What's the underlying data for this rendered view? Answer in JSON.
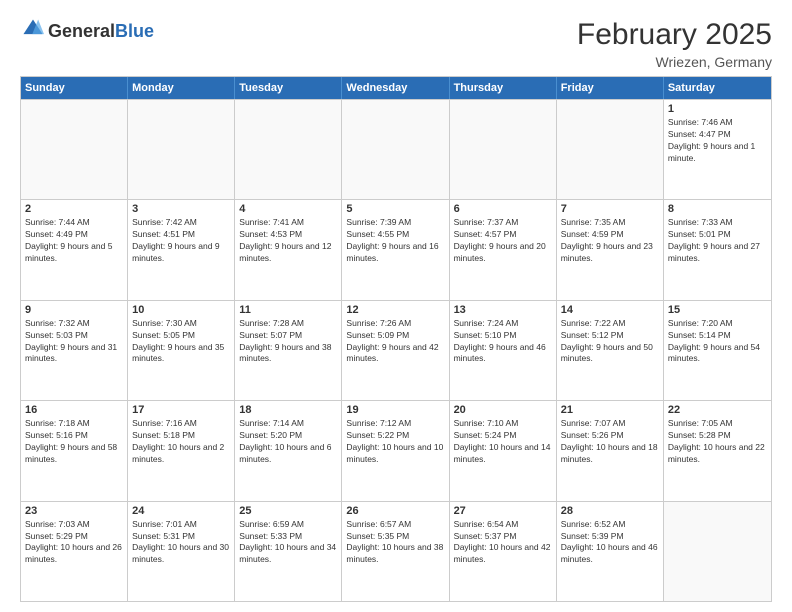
{
  "header": {
    "logo_general": "General",
    "logo_blue": "Blue",
    "month_title": "February 2025",
    "location": "Wriezen, Germany"
  },
  "weekdays": [
    "Sunday",
    "Monday",
    "Tuesday",
    "Wednesday",
    "Thursday",
    "Friday",
    "Saturday"
  ],
  "rows": [
    [
      {
        "day": "",
        "info": ""
      },
      {
        "day": "",
        "info": ""
      },
      {
        "day": "",
        "info": ""
      },
      {
        "day": "",
        "info": ""
      },
      {
        "day": "",
        "info": ""
      },
      {
        "day": "",
        "info": ""
      },
      {
        "day": "1",
        "info": "Sunrise: 7:46 AM\nSunset: 4:47 PM\nDaylight: 9 hours and 1 minute."
      }
    ],
    [
      {
        "day": "2",
        "info": "Sunrise: 7:44 AM\nSunset: 4:49 PM\nDaylight: 9 hours and 5 minutes."
      },
      {
        "day": "3",
        "info": "Sunrise: 7:42 AM\nSunset: 4:51 PM\nDaylight: 9 hours and 9 minutes."
      },
      {
        "day": "4",
        "info": "Sunrise: 7:41 AM\nSunset: 4:53 PM\nDaylight: 9 hours and 12 minutes."
      },
      {
        "day": "5",
        "info": "Sunrise: 7:39 AM\nSunset: 4:55 PM\nDaylight: 9 hours and 16 minutes."
      },
      {
        "day": "6",
        "info": "Sunrise: 7:37 AM\nSunset: 4:57 PM\nDaylight: 9 hours and 20 minutes."
      },
      {
        "day": "7",
        "info": "Sunrise: 7:35 AM\nSunset: 4:59 PM\nDaylight: 9 hours and 23 minutes."
      },
      {
        "day": "8",
        "info": "Sunrise: 7:33 AM\nSunset: 5:01 PM\nDaylight: 9 hours and 27 minutes."
      }
    ],
    [
      {
        "day": "9",
        "info": "Sunrise: 7:32 AM\nSunset: 5:03 PM\nDaylight: 9 hours and 31 minutes."
      },
      {
        "day": "10",
        "info": "Sunrise: 7:30 AM\nSunset: 5:05 PM\nDaylight: 9 hours and 35 minutes."
      },
      {
        "day": "11",
        "info": "Sunrise: 7:28 AM\nSunset: 5:07 PM\nDaylight: 9 hours and 38 minutes."
      },
      {
        "day": "12",
        "info": "Sunrise: 7:26 AM\nSunset: 5:09 PM\nDaylight: 9 hours and 42 minutes."
      },
      {
        "day": "13",
        "info": "Sunrise: 7:24 AM\nSunset: 5:10 PM\nDaylight: 9 hours and 46 minutes."
      },
      {
        "day": "14",
        "info": "Sunrise: 7:22 AM\nSunset: 5:12 PM\nDaylight: 9 hours and 50 minutes."
      },
      {
        "day": "15",
        "info": "Sunrise: 7:20 AM\nSunset: 5:14 PM\nDaylight: 9 hours and 54 minutes."
      }
    ],
    [
      {
        "day": "16",
        "info": "Sunrise: 7:18 AM\nSunset: 5:16 PM\nDaylight: 9 hours and 58 minutes."
      },
      {
        "day": "17",
        "info": "Sunrise: 7:16 AM\nSunset: 5:18 PM\nDaylight: 10 hours and 2 minutes."
      },
      {
        "day": "18",
        "info": "Sunrise: 7:14 AM\nSunset: 5:20 PM\nDaylight: 10 hours and 6 minutes."
      },
      {
        "day": "19",
        "info": "Sunrise: 7:12 AM\nSunset: 5:22 PM\nDaylight: 10 hours and 10 minutes."
      },
      {
        "day": "20",
        "info": "Sunrise: 7:10 AM\nSunset: 5:24 PM\nDaylight: 10 hours and 14 minutes."
      },
      {
        "day": "21",
        "info": "Sunrise: 7:07 AM\nSunset: 5:26 PM\nDaylight: 10 hours and 18 minutes."
      },
      {
        "day": "22",
        "info": "Sunrise: 7:05 AM\nSunset: 5:28 PM\nDaylight: 10 hours and 22 minutes."
      }
    ],
    [
      {
        "day": "23",
        "info": "Sunrise: 7:03 AM\nSunset: 5:29 PM\nDaylight: 10 hours and 26 minutes."
      },
      {
        "day": "24",
        "info": "Sunrise: 7:01 AM\nSunset: 5:31 PM\nDaylight: 10 hours and 30 minutes."
      },
      {
        "day": "25",
        "info": "Sunrise: 6:59 AM\nSunset: 5:33 PM\nDaylight: 10 hours and 34 minutes."
      },
      {
        "day": "26",
        "info": "Sunrise: 6:57 AM\nSunset: 5:35 PM\nDaylight: 10 hours and 38 minutes."
      },
      {
        "day": "27",
        "info": "Sunrise: 6:54 AM\nSunset: 5:37 PM\nDaylight: 10 hours and 42 minutes."
      },
      {
        "day": "28",
        "info": "Sunrise: 6:52 AM\nSunset: 5:39 PM\nDaylight: 10 hours and 46 minutes."
      },
      {
        "day": "",
        "info": ""
      }
    ]
  ]
}
